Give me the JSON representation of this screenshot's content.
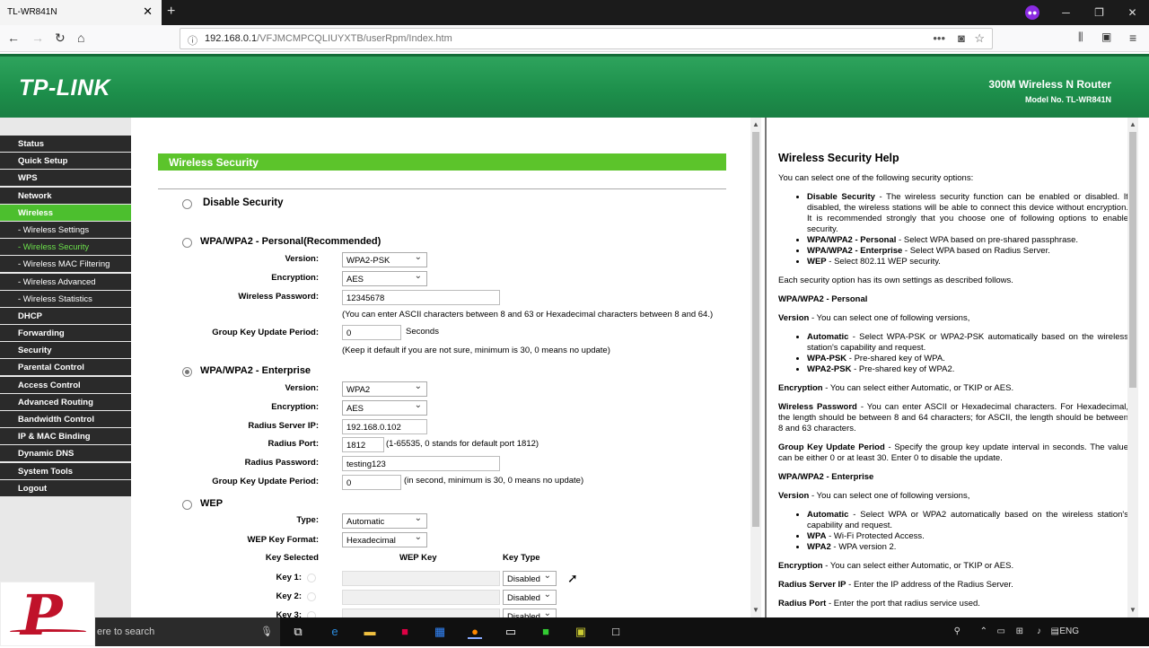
{
  "browser": {
    "tab_title": "TL-WR841N",
    "tab_close": "✕",
    "new_tab": "+",
    "url_host": "192.168.0.1",
    "url_path": "/VFJMCMPCQLIUYXTB/userRpm/Index.htm",
    "menu_dots": "•••"
  },
  "header": {
    "logo": "TP-LINK",
    "product": "300M Wireless N Router",
    "model": "Model No. TL-WR841N"
  },
  "menu": {
    "items": [
      {
        "label": "Status"
      },
      {
        "label": "Quick Setup"
      },
      {
        "label": "WPS"
      },
      {
        "label": "Network"
      },
      {
        "label": "Wireless"
      },
      {
        "label": "- Wireless Settings"
      },
      {
        "label": "- Wireless Security"
      },
      {
        "label": "- Wireless MAC Filtering"
      },
      {
        "label": "- Wireless Advanced"
      },
      {
        "label": "- Wireless Statistics"
      },
      {
        "label": "DHCP"
      },
      {
        "label": "Forwarding"
      },
      {
        "label": "Security"
      },
      {
        "label": "Parental Control"
      },
      {
        "label": "Access Control"
      },
      {
        "label": "Advanced Routing"
      },
      {
        "label": "Bandwidth Control"
      },
      {
        "label": "IP & MAC Binding"
      },
      {
        "label": "Dynamic DNS"
      },
      {
        "label": "System Tools"
      },
      {
        "label": "Logout"
      }
    ]
  },
  "main": {
    "title": "Wireless Security",
    "disable": {
      "title": "Disable Security"
    },
    "personal": {
      "title": "WPA/WPA2 - Personal(Recommended)",
      "version_label": "Version:",
      "version_value": "WPA2-PSK",
      "encryption_label": "Encryption:",
      "encryption_value": "AES",
      "password_label": "Wireless Password:",
      "password_value": "12345678",
      "password_note": "(You can enter ASCII characters between 8 and 63 or Hexadecimal characters between 8 and 64.)",
      "gkup_label": "Group Key Update Period:",
      "gkup_value": "0",
      "gkup_unit": "Seconds",
      "gkup_note": "(Keep it default if you are not sure, minimum is 30, 0 means no update)"
    },
    "enterprise": {
      "title": "WPA/WPA2 - Enterprise",
      "version_label": "Version:",
      "version_value": "WPA2",
      "encryption_label": "Encryption:",
      "encryption_value": "AES",
      "radius_ip_label": "Radius Server IP:",
      "radius_ip_value": "192.168.0.102",
      "radius_port_label": "Radius Port:",
      "radius_port_value": "1812",
      "radius_port_note": "(1-65535, 0 stands for default port 1812)",
      "radius_pw_label": "Radius Password:",
      "radius_pw_value": "testing123",
      "gkup_label": "Group Key Update Period:",
      "gkup_value": "0",
      "gkup_note": "(in second, minimum is 30, 0 means no update)"
    },
    "wep": {
      "title": "WEP",
      "type_label": "Type:",
      "type_value": "Automatic",
      "format_label": "WEP Key Format:",
      "format_value": "Hexadecimal",
      "col_selected": "Key Selected",
      "col_key": "WEP Key",
      "col_type": "Key Type",
      "keys": [
        {
          "label": "Key 1:",
          "type": "Disabled"
        },
        {
          "label": "Key 2:",
          "type": "Disabled"
        },
        {
          "label": "Key 3:",
          "type": "Disabled"
        }
      ]
    }
  },
  "help": {
    "title": "Wireless Security Help",
    "intro": "You can select one of the following security options:",
    "opts": [
      {
        "b": "Disable Security",
        "t": " - The wireless security function can be enabled or disabled. If disabled, the wireless stations will be able to connect this device without encryption. It is recommended strongly that you choose one of following options to enable security."
      },
      {
        "b": "WPA/WPA2 - Personal",
        "t": " - Select WPA based on pre-shared passphrase."
      },
      {
        "b": "WPA/WPA2 - Enterprise",
        "t": " - Select WPA based on Radius Server."
      },
      {
        "b": "WEP",
        "t": " - Select 802.11 WEP security."
      }
    ],
    "each": "Each security option has its own settings as described follows.",
    "personal_head": "WPA/WPA2 - Personal",
    "version_b": "Version",
    "version_t": " - You can select one of following versions,",
    "personal_versions": [
      {
        "b": "Automatic",
        "t": " - Select WPA-PSK or WPA2-PSK automatically based on the wireless station's capability and request."
      },
      {
        "b": "WPA-PSK",
        "t": " - Pre-shared key of WPA."
      },
      {
        "b": "WPA2-PSK",
        "t": " - Pre-shared key of WPA2."
      }
    ],
    "enc_b": "Encryption",
    "enc_t": " - You can select either Automatic, or TKIP or AES.",
    "wpw_b": "Wireless Password",
    "wpw_t": " - You can enter ASCII or Hexadecimal characters. For Hexadecimal, the length should be between 8 and 64 characters; for ASCII, the length should be between 8 and 63 characters.",
    "gkup_b": "Group Key Update Period",
    "gkup_t": " - Specify the group key update interval in seconds. The value can be either 0 or at least 30. Enter 0 to disable the update.",
    "ent_head": "WPA/WPA2 - Enterprise",
    "ent_versions": [
      {
        "b": "Automatic",
        "t": " - Select WPA or WPA2 automatically based on the wireless station's capability and request."
      },
      {
        "b": "WPA",
        "t": " - Wi-Fi Protected Access."
      },
      {
        "b": "WPA2",
        "t": " - WPA version 2."
      }
    ],
    "rsip_b": "Radius Server IP",
    "rsip_t": " - Enter the IP address of the Radius Server.",
    "rport_b": "Radius Port",
    "rport_t": " - Enter the port that radius service used."
  },
  "taskbar": {
    "search_text": "ere to search",
    "lang": "ENG"
  },
  "watermark": {
    "letter": "P"
  }
}
